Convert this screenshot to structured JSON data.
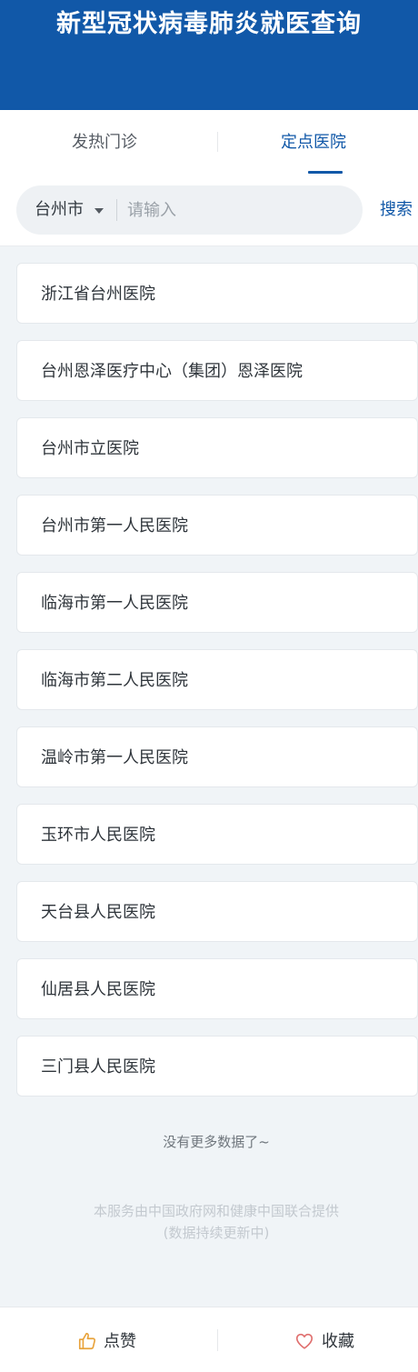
{
  "header": {
    "title": "新型冠状病毒肺炎就医查询"
  },
  "tabs": [
    {
      "label": "发热门诊",
      "active": false
    },
    {
      "label": "定点医院",
      "active": true
    }
  ],
  "search": {
    "city": "台州市",
    "placeholder": "请输入",
    "value": "",
    "button_label": "搜索"
  },
  "hospitals": [
    "浙江省台州医院",
    "台州恩泽医疗中心（集团）恩泽医院",
    "台州市立医院",
    "台州市第一人民医院",
    "临海市第一人民医院",
    "临海市第二人民医院",
    "温岭市第一人民医院",
    "玉环市人民医院",
    "天台县人民医院",
    "仙居县人民医院",
    "三门县人民医院"
  ],
  "list_end_text": "没有更多数据了~",
  "footer": {
    "line1": "本服务由中国政府网和健康中国联合提供",
    "line2": "(数据持续更新中)"
  },
  "bottom_bar": {
    "like_label": "点赞",
    "like_icon": "thumbs-up-icon",
    "favorite_label": "收藏",
    "favorite_icon": "heart-icon"
  },
  "colors": {
    "brand": "#1158a8",
    "like_icon": "#e8a33c",
    "favorite_icon": "#e0706f"
  }
}
